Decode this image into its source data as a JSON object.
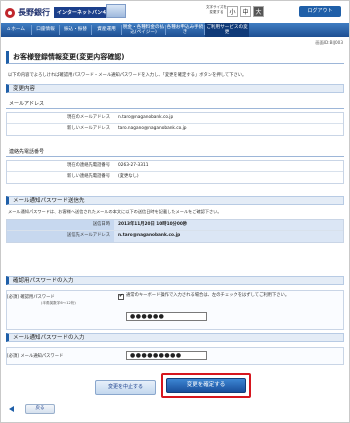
{
  "header": {
    "bank_name": "長野銀行",
    "service_tag": "インターネットバンキング",
    "font_size_label_1": "文字サイズを",
    "font_size_label_2": "変更する",
    "font_small": "小",
    "font_mid": "中",
    "font_large": "大",
    "logout_label": "ログアウト"
  },
  "nav": {
    "items": [
      {
        "label": "ホーム"
      },
      {
        "label": "口座情報"
      },
      {
        "label": "振込・振替"
      },
      {
        "label": "資産運用"
      },
      {
        "label": "税金・各種料金の払込(ペイジー)"
      },
      {
        "label": "各種お申込み手続き"
      },
      {
        "label": "ご利用サービスの変更"
      }
    ]
  },
  "screen_id": "画面ID:BIJ003",
  "page_title": "お客様登録情報変更(変更内容確認)",
  "intro_text": "以下の内容でよろしければ確認用パスワード・メール通知パスワードを入力し、「変更を確定する」ボタンを押して下さい。",
  "change_section": {
    "heading": "変更内容",
    "email": {
      "heading": "メールアドレス",
      "rows": [
        {
          "label": "現在のメールアドレス",
          "value": "n.taro@naganobank.co.jp"
        },
        {
          "label": "新しいメールアドレス",
          "value": "taro.nagano@naganobank.co.jp"
        }
      ]
    },
    "phone": {
      "heading": "連絡先電話番号",
      "rows": [
        {
          "label": "現在の連絡先電話番号",
          "value": "0263-27-3311"
        },
        {
          "label": "新しい連絡先電話番号",
          "value": "(変更なし)"
        }
      ]
    }
  },
  "notify_section": {
    "heading": "メール通知パスワード送信先",
    "note": "メール通知パスワードは、お客様へ送信されたメールの本文に以下の送信日時を記載したメールをご確認下さい。",
    "rows": [
      {
        "label": "送信日時",
        "value": "2013年11月20日 10時10分00秒"
      },
      {
        "label": "送信先メールアドレス",
        "value": "n.taro@naganobank.co.jp"
      }
    ]
  },
  "confirm_pw_section": {
    "heading": "確認用パスワードの入力",
    "required": "[必須]",
    "label": "確認用パスワード",
    "sub_label": "(半角英数字6〜12桁)",
    "checkbox_text": "通常のキーボード操作で入力される場合は、左のチェックをはずしてご利用下さい。",
    "value": "●●●●●●"
  },
  "mail_pw_section": {
    "heading": "メール通知パスワードの入力",
    "required": "[必須]",
    "label": "メール通知パスワード",
    "value": "●●●●●●●●●"
  },
  "buttons": {
    "cancel": "変更を中止する",
    "confirm": "変更を確定する",
    "back": "戻る"
  },
  "colors": {
    "accent": "#1f5fa8",
    "highlight": "#d6161e"
  }
}
